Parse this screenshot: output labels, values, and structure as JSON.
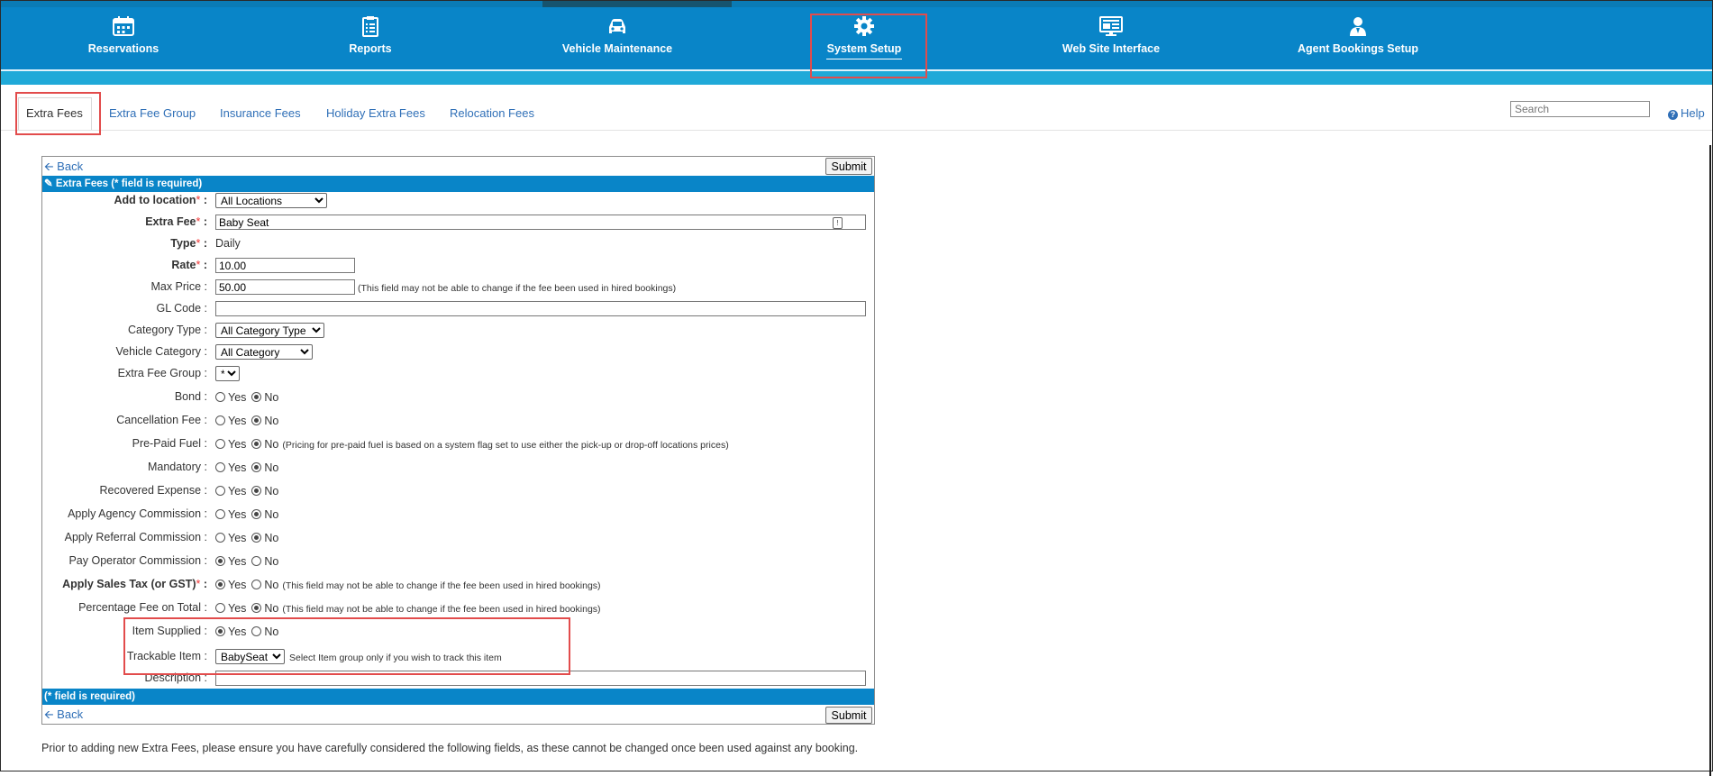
{
  "nav": {
    "items": [
      {
        "label": "Reservations",
        "icon": "calendar-icon"
      },
      {
        "label": "Reports",
        "icon": "clipboard-icon"
      },
      {
        "label": "Vehicle Maintenance",
        "icon": "car-icon"
      },
      {
        "label": "System Setup",
        "icon": "gear-icon",
        "active": true
      },
      {
        "label": "Web Site Interface",
        "icon": "monitor-icon"
      },
      {
        "label": "Agent Bookings Setup",
        "icon": "agent-icon"
      }
    ]
  },
  "tabs": [
    "Extra Fees",
    "Extra Fee Group",
    "Insurance Fees",
    "Holiday Extra Fees",
    "Relocation Fees"
  ],
  "search": {
    "placeholder": "Search"
  },
  "help_label": "Help",
  "form": {
    "back_label": "Back",
    "submit_label": "Submit",
    "header_title": "Extra Fees (* field is required)",
    "footer_title": "(* field is required)",
    "fields": {
      "add_to_location": {
        "label": "Add to location",
        "value": "All Locations"
      },
      "extra_fee": {
        "label": "Extra Fee",
        "value": "Baby Seat"
      },
      "type": {
        "label": "Type",
        "value": "Daily"
      },
      "rate": {
        "label": "Rate",
        "value": "10.00"
      },
      "max_price": {
        "label": "Max Price",
        "value": "50.00",
        "note": "(This field may not be able to change if the fee been used in hired bookings)"
      },
      "gl_code": {
        "label": "GL Code",
        "value": ""
      },
      "category_type": {
        "label": "Category Type",
        "value": "All Category Type"
      },
      "vehicle_category": {
        "label": "Vehicle Category",
        "value": "All Category"
      },
      "extra_fee_group": {
        "label": "Extra Fee Group",
        "value": "*"
      },
      "bond": {
        "label": "Bond",
        "selected": "No"
      },
      "cancellation_fee": {
        "label": "Cancellation Fee",
        "selected": "No"
      },
      "pre_paid_fuel": {
        "label": "Pre-Paid Fuel",
        "selected": "No",
        "note": "(Pricing for pre-paid fuel is based on a system flag set to use either the pick-up or drop-off locations prices)"
      },
      "mandatory": {
        "label": "Mandatory",
        "selected": "No"
      },
      "recovered_expense": {
        "label": "Recovered Expense",
        "selected": "No"
      },
      "apply_agency_commission": {
        "label": "Apply Agency Commission",
        "selected": "No"
      },
      "apply_referral_commission": {
        "label": "Apply Referral Commission",
        "selected": "No"
      },
      "pay_operator_commission": {
        "label": "Pay Operator Commission",
        "selected": "Yes"
      },
      "apply_sales_tax": {
        "label": "Apply Sales Tax (or GST)",
        "selected": "Yes",
        "note": "(This field may not be able to change if the fee been used in hired bookings)"
      },
      "percentage_fee_on_total": {
        "label": "Percentage Fee on Total",
        "selected": "No",
        "note": "(This field may not be able to change if the fee been used in hired bookings)"
      },
      "item_supplied": {
        "label": "Item Supplied",
        "selected": "Yes"
      },
      "trackable_item": {
        "label": "Trackable Item",
        "value": "BabySeat",
        "note": "Select Item group only if you wish to track this item"
      },
      "description": {
        "label": "Description",
        "value": ""
      }
    },
    "yes_label": "Yes",
    "no_label": "No"
  },
  "footer_text": "Prior to adding new Extra Fees, please ensure you have carefully considered the following fields, as these cannot be changed once been used against any booking.",
  "colors": {
    "nav_bg": "#0985c8",
    "link": "#2f6fb7",
    "required": "#ee3333",
    "highlight": "#e24c4c"
  }
}
